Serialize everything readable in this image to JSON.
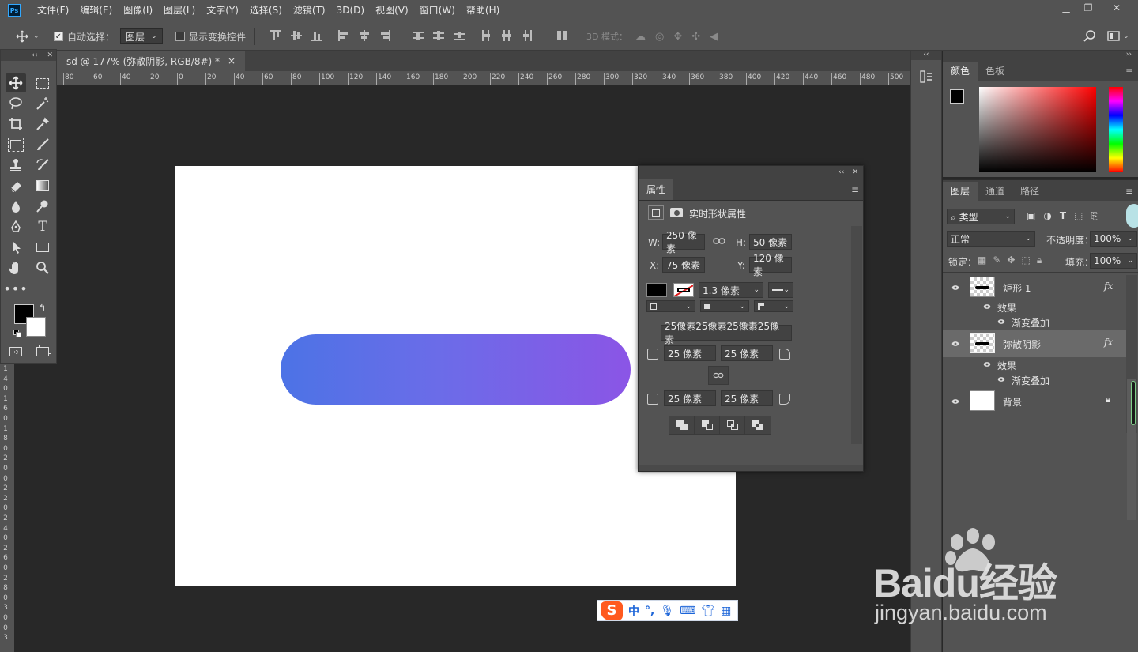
{
  "menubar": {
    "app_icon": "Ps",
    "items": [
      "文件(F)",
      "编辑(E)",
      "图像(I)",
      "图层(L)",
      "文字(Y)",
      "选择(S)",
      "滤镜(T)",
      "3D(D)",
      "视图(V)",
      "窗口(W)",
      "帮助(H)"
    ]
  },
  "options": {
    "auto_select_label": "自动选择：",
    "auto_select_value": "图层",
    "show_transform_label": "显示变换控件",
    "mode_3d_label": "3D 模式："
  },
  "document": {
    "tab_title": "sd @ 177% (弥散阴影, RGB/8#) *",
    "close": "×"
  },
  "ruler": {
    "h_labels": [
      "80",
      "60",
      "40",
      "20",
      "0",
      "20",
      "40",
      "60",
      "80",
      "100",
      "120",
      "140",
      "160",
      "180",
      "200",
      "220",
      "240",
      "260",
      "280",
      "300",
      "320",
      "340",
      "360",
      "380",
      "400",
      "420",
      "440",
      "460",
      "480",
      "500"
    ],
    "v_labels": [
      "1",
      "4",
      "0",
      "1",
      "6",
      "0",
      "1",
      "8",
      "0",
      "2",
      "0",
      "0",
      "2",
      "2",
      "0",
      "2",
      "4",
      "0",
      "2",
      "6",
      "0",
      "2",
      "8",
      "0",
      "3",
      "0",
      "0",
      "3"
    ]
  },
  "properties": {
    "tab_label": "属性",
    "section_title": "实时形状属性",
    "w_label": "W:",
    "w_value": "250 像素",
    "h_label": "H:",
    "h_value": "50 像素",
    "x_label": "X:",
    "x_value": "75 像素",
    "y_label": "Y:",
    "y_value": "120 像素",
    "stroke_width": "1.3 像素",
    "corners_summary": "25像素25像素25像素25像素",
    "corner_tl": "25 像素",
    "corner_tr": "25 像素",
    "corner_bl": "25 像素",
    "corner_br": "25 像素"
  },
  "color_panel": {
    "tabs": [
      "颜色",
      "色板"
    ]
  },
  "layers_panel": {
    "tabs": [
      "图层",
      "通道",
      "路径"
    ],
    "filter_label": "类型",
    "blend_mode": "正常",
    "opacity_label": "不透明度：",
    "opacity_value": "100%",
    "lock_label": "锁定：",
    "fill_label": "填充：",
    "fill_value": "100%",
    "layers": [
      {
        "name": "矩形 1",
        "fx": "fx",
        "effects_label": "效果",
        "effect": "渐变叠加"
      },
      {
        "name": "弥散阴影",
        "fx": "fx",
        "effects_label": "效果",
        "effect": "渐变叠加"
      },
      {
        "name": "背景"
      }
    ]
  },
  "ime": {
    "lang": "中"
  },
  "watermark": {
    "brand": "Baidu经验",
    "url": "jingyan.baidu.com"
  },
  "colors": {
    "pill_start": "#4c73e6",
    "pill_end": "#8b55e6",
    "panel_bg": "#535353",
    "workspace": "#282828"
  }
}
